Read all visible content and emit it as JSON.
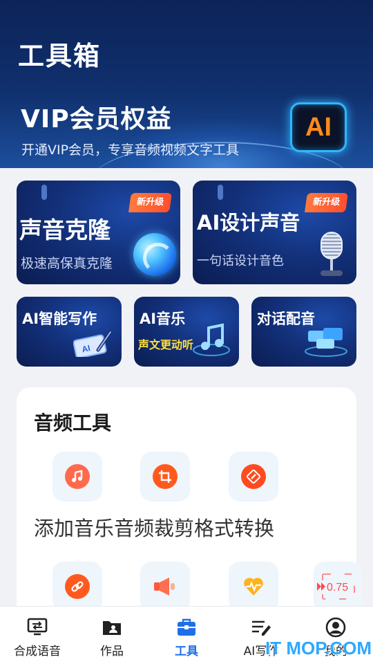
{
  "header": {
    "title": "工具箱",
    "vip_title": "VIP会员权益",
    "vip_subtitle": "开通VIP会员，专享音频视频文字工具",
    "ai_badge": "AI"
  },
  "feature_cards": [
    {
      "title": "声音克隆",
      "subtitle": "极速高保真克隆",
      "tag": "新升级",
      "icon": "swirl-orb-icon"
    },
    {
      "title": "AI设计声音",
      "subtitle": "一句话设计音色",
      "tag": "新升级",
      "icon": "microphone-icon"
    }
  ],
  "small_cards": [
    {
      "title": "AI智能写作",
      "icon": "ai-pen-writing-icon"
    },
    {
      "title": "AI音乐",
      "accent": "声文更动听",
      "icon": "music-note-icon"
    },
    {
      "title": "对话配音",
      "icon": "chat-bubbles-icon"
    }
  ],
  "audio_tools": {
    "title": "音频工具",
    "labels_text": "添加音乐音频裁剪格式转换",
    "tools_row1": [
      {
        "icon": "music-note-icon",
        "color": "#ff6a4d"
      },
      {
        "icon": "crop-icon",
        "color": "#ff5a1e"
      },
      {
        "icon": "convert-icon",
        "color": "#ff4b1f"
      }
    ],
    "tools_row2": [
      {
        "icon": "link-icon",
        "color": "#ff5a1e"
      },
      {
        "icon": "megaphone-icon",
        "color": "#ff5a3c"
      },
      {
        "icon": "heart-waveform-icon",
        "color": "#ffb21c"
      },
      {
        "icon": "speed-icon",
        "text": "0.75",
        "color": "#ff4b4b"
      }
    ]
  },
  "bottom_nav": [
    {
      "label": "合成语音",
      "icon": "synthesize-icon",
      "active": false
    },
    {
      "label": "作品",
      "icon": "folder-user-icon",
      "active": false
    },
    {
      "label": "工具",
      "icon": "toolbox-icon",
      "active": true
    },
    {
      "label": "AI写作",
      "icon": "write-lines-icon",
      "active": false
    },
    {
      "label": "我的",
      "icon": "user-circle-icon",
      "active": false
    }
  ],
  "watermark": "IT MOP.COM",
  "colors": {
    "header_dark": "#0d2358",
    "active_nav": "#1f6fea",
    "tag_orange": "#ff5a2e",
    "accent_yellow": "#ffe03a"
  }
}
